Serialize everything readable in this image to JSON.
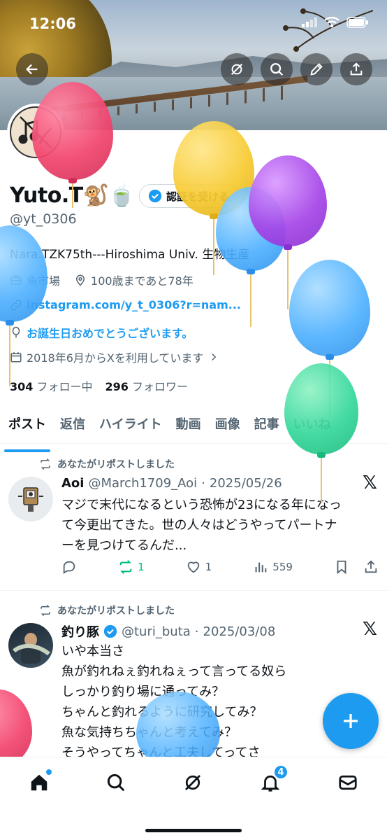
{
  "status_bar": {
    "time": "12:06"
  },
  "profile": {
    "display_name": "Yuto.T🐒🍵",
    "verify_label": "認証を受ける",
    "handle": "@yt_0306",
    "bio": "Nara.TZK75th---Hiroshima Univ. 生物生産",
    "category": "魚市場",
    "location": "100歳まであと78年",
    "link": "instagram.com/y_t_0306?r=nam...",
    "birthday_message": "お誕生日おめでとうございます。",
    "joined": "2018年6月からXを利用しています",
    "following_count": "304",
    "following_label": "フォロー中",
    "followers_count": "296",
    "followers_label": "フォロワー"
  },
  "tabs": [
    "ポスト",
    "返信",
    "ハイライト",
    "動画",
    "画像",
    "記事",
    "いいね"
  ],
  "posts": [
    {
      "repost_label": "あなたがリポストしました",
      "name": "Aoi",
      "handle": "@March1709_Aoi",
      "date": "2025/05/26",
      "text_lines": [
        "マジで末代になるという恐怖が23になる年になっ",
        "て今更出てきた。世の人々はどうやってパートナ",
        "ーを見つけてるんだ..."
      ],
      "retweets": "1",
      "likes": "1",
      "views": "559"
    },
    {
      "repost_label": "あなたがリポストしました",
      "name": "釣り豚",
      "handle": "@turi_buta",
      "date": "2025/03/08",
      "text_lines": [
        "いや本当さ",
        "魚が釣れねぇ釣れねぇって言ってる奴ら",
        "しっかり釣り場に通ってみ？",
        "ちゃんと釣れるように研究してみ？",
        "魚な気持ちちゃんと考えてみ？",
        "そうやってちゃんと工夫してってさ"
      ]
    }
  ],
  "x_logo": "𝕏",
  "nav": {
    "notification_badge": "4"
  },
  "colors": {
    "accent": "#1d9bf0",
    "repost_green": "#00ba7c"
  }
}
